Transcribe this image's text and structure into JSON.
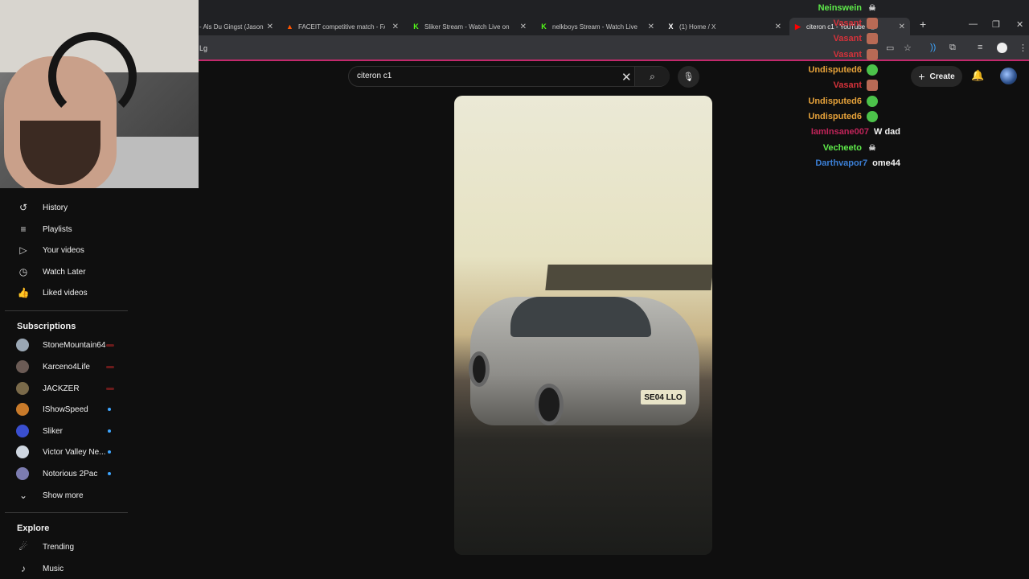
{
  "browser": {
    "tabs": [
      {
        "title": "- Als Du Gingst (Jason",
        "favicon_color": "#888888",
        "favicon": ""
      },
      {
        "title": "FACEIT competitive match - FA",
        "favicon_color": "#ff5500",
        "favicon": "▲"
      },
      {
        "title": "Sliker Stream - Watch Live on K",
        "favicon_color": "#53fc18",
        "favicon": "K"
      },
      {
        "title": "nelkboys Stream - Watch Live o",
        "favicon_color": "#53fc18",
        "favicon": "K"
      },
      {
        "title": "(1) Home / X",
        "favicon_color": "#ffffff",
        "favicon": "𝕏"
      },
      {
        "title": "citeron c1 - YouTube",
        "favicon_color": "#ff0000",
        "favicon": "▶"
      }
    ],
    "new_tab": "+",
    "url_fragment": "Lg"
  },
  "search": {
    "value": "citeron c1",
    "placeholder": "Search"
  },
  "masthead": {
    "create_label": "Create"
  },
  "sidebar": {
    "you_items": [
      {
        "label": "History",
        "icon": "history-icon",
        "glyph": "↺"
      },
      {
        "label": "Playlists",
        "icon": "playlists-icon",
        "glyph": "≡"
      },
      {
        "label": "Your videos",
        "icon": "your-videos-icon",
        "glyph": "▷"
      },
      {
        "label": "Watch Later",
        "icon": "clock-icon",
        "glyph": "◷"
      },
      {
        "label": "Liked videos",
        "icon": "thumbs-up-icon",
        "glyph": "👍"
      }
    ],
    "subscriptions_title": "Subscriptions",
    "subscriptions": [
      {
        "label": "StoneMountain64",
        "avatar_color": "#9aa7b4",
        "status": "live"
      },
      {
        "label": "Karceno4Life",
        "avatar_color": "#6b5b55",
        "status": "live"
      },
      {
        "label": "JACKZER",
        "avatar_color": "#7a6a4a",
        "status": "live"
      },
      {
        "label": "IShowSpeed",
        "avatar_color": "#c87a2a",
        "status": "new"
      },
      {
        "label": "Sliker",
        "avatar_color": "#3a4fd0",
        "status": "new"
      },
      {
        "label": "Victor Valley Ne...",
        "avatar_color": "#cfd6e0",
        "status": "new"
      },
      {
        "label": "Notorious 2Pac",
        "avatar_color": "#7c7cb0",
        "status": "new"
      }
    ],
    "show_more": "Show more",
    "explore_title": "Explore",
    "explore_items": [
      {
        "label": "Trending",
        "icon": "trending-icon",
        "glyph": "☄"
      },
      {
        "label": "Music",
        "icon": "music-icon",
        "glyph": "♪"
      }
    ]
  },
  "video": {
    "plate_text": "SE04 LLO"
  },
  "chat": [
    {
      "user": "Neinswein",
      "color": "#5eea4a",
      "msg": "",
      "emote": "skull",
      "emote_color": "#dddddd"
    },
    {
      "user": "Vasant",
      "color": "#d5323a",
      "msg": "",
      "emote": "face",
      "emote_color": "#b86a55"
    },
    {
      "user": "Vasant",
      "color": "#d5323a",
      "msg": "",
      "emote": "face",
      "emote_color": "#b86a55"
    },
    {
      "user": "Vasant",
      "color": "#d5323a",
      "msg": "",
      "emote": "face",
      "emote_color": "#b86a55"
    },
    {
      "user": "Undisputed6",
      "color": "#e6a23a",
      "msg": "",
      "emote": "green-blob",
      "emote_color": "#4cc24a"
    },
    {
      "user": "Vasant",
      "color": "#d5323a",
      "msg": "",
      "emote": "face",
      "emote_color": "#b86a55"
    },
    {
      "user": "Undisputed6",
      "color": "#e6a23a",
      "msg": "",
      "emote": "green-blob",
      "emote_color": "#4cc24a"
    },
    {
      "user": "Undisputed6",
      "color": "#e6a23a",
      "msg": "",
      "emote": "green-blob",
      "emote_color": "#4cc24a"
    },
    {
      "user": "IamInsane007",
      "color": "#c2245a",
      "msg": "W dad",
      "emote": "",
      "emote_color": ""
    },
    {
      "user": "Vecheeto",
      "color": "#5eea4a",
      "msg": "",
      "emote": "skull",
      "emote_color": "#dddddd"
    },
    {
      "user": "Darthvapor7",
      "color": "#3b7fd6",
      "msg": "ome44",
      "emote": "",
      "emote_color": ""
    }
  ]
}
